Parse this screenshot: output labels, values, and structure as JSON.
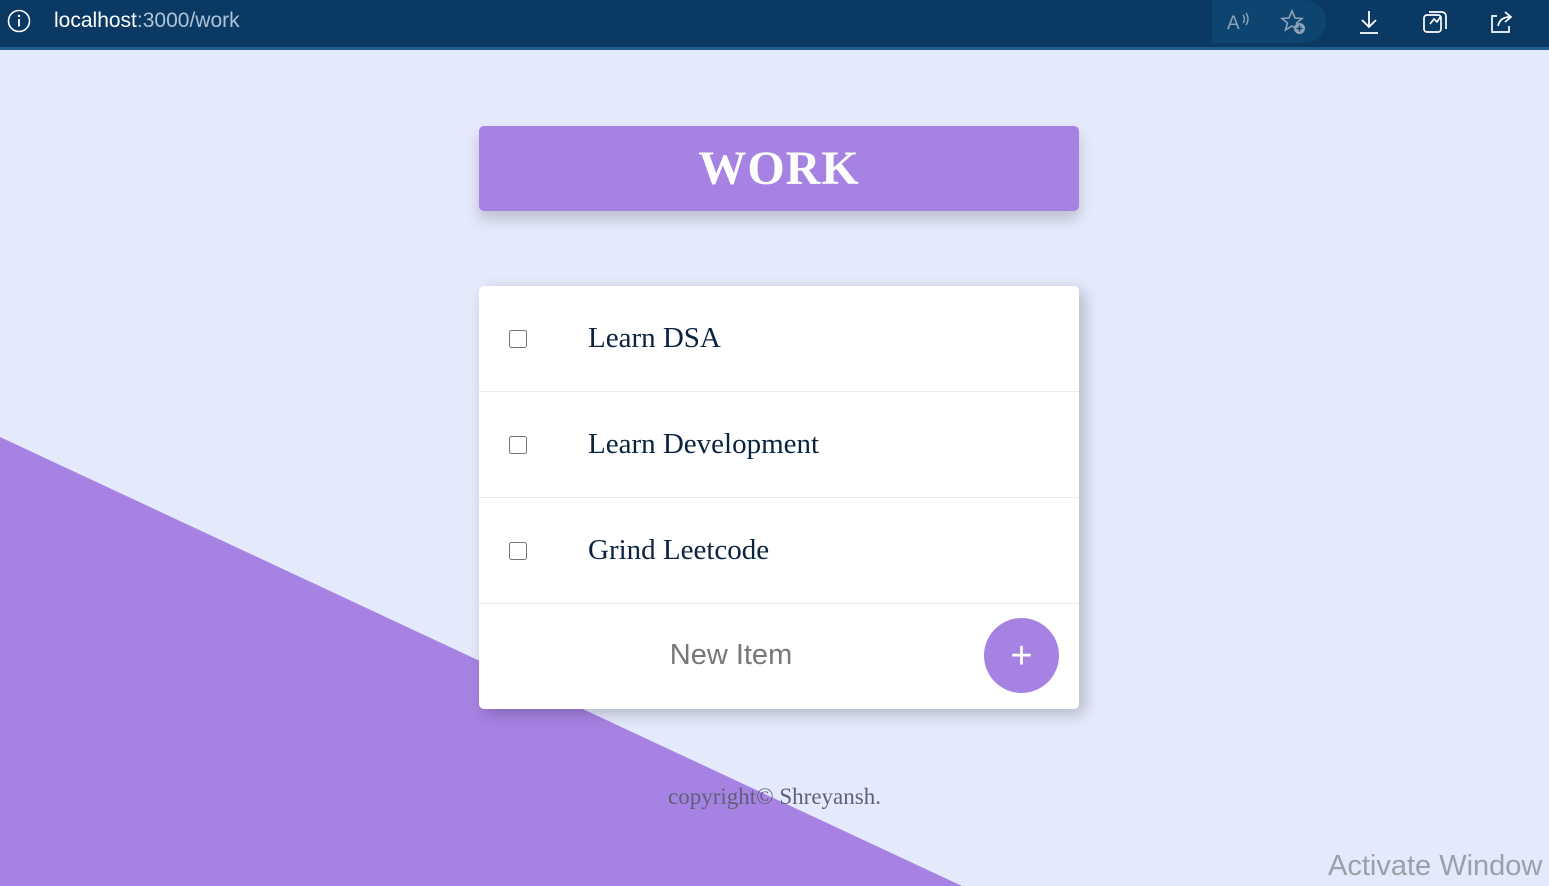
{
  "browser": {
    "url_host": "localhost",
    "url_path": ":3000/work",
    "icons": [
      "info-icon",
      "read-aloud-icon",
      "add-favorite-icon",
      "download-icon",
      "collections-icon",
      "share-icon"
    ]
  },
  "page": {
    "title": "WORK",
    "items": [
      {
        "label": "Learn DSA",
        "checked": false
      },
      {
        "label": "Learn Development",
        "checked": false
      },
      {
        "label": "Grind Leetcode",
        "checked": false
      }
    ],
    "new_item_placeholder": "New Item",
    "add_button_label": "+",
    "footer": "copyright© Shreyansh."
  },
  "os": {
    "watermark": "Activate Window"
  },
  "colors": {
    "background": "#E4E9FB",
    "accent": "#A683E3",
    "browser_bar": "#0A3A63",
    "item_text": "#0A2340"
  }
}
